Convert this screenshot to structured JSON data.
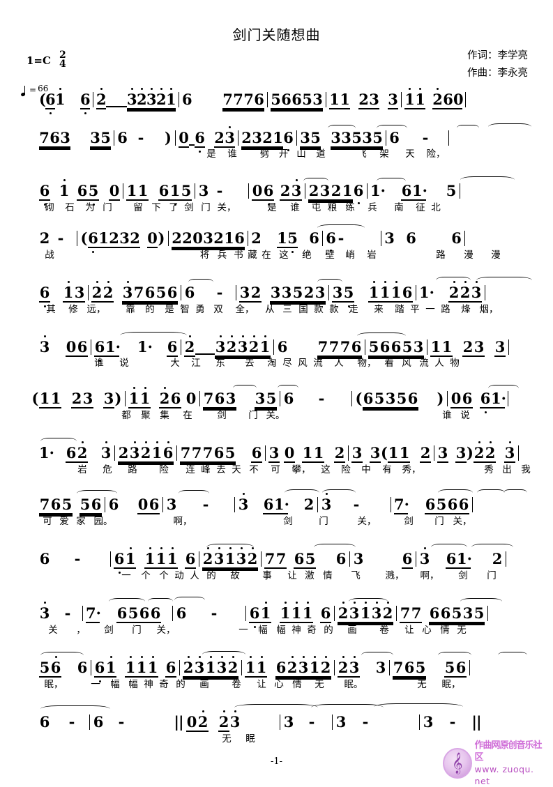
{
  "header": {
    "title": "剑门关随想曲",
    "lyricist": "作词：李学亮",
    "composer": "作曲：李永亮",
    "key_label": "1=C",
    "meter_num": "2",
    "meter_den": "4",
    "tempo_value": "66",
    "tempo_icon": "quarter-note-icon"
  },
  "footer": {
    "page_number": "-1-",
    "watermark_text": "作曲网原创音乐社区",
    "watermark_url": "www. zuoqu. net",
    "watermark_icon": "treble-clef-icon"
  },
  "score": {
    "lines": [
      {
        "id": "line-1",
        "notes": "( 6 1   6  | 2   3 2 3 2 1 | 6    7 7 7 6 | 5 6 6 5 3  | 1 1  2 3  3  | 1 1  2 6 0 |",
        "lyrics": ""
      },
      {
        "id": "line-2",
        "notes": "7 6 3   3 5 | 6  -   ) | 0 6  2 3 | 2 3 2 1 6 | 3 5  3 3 5 3 5 | 6   - |",
        "lyrics": "是 谁　劈开山 道　飞　架天　　险，"
      },
      {
        "id": "line-3",
        "notes": "6 1  6 5 0 | 1 1  6 1 5 | 3 - | 0 6 2 3 | 2 3 2 1 6 | 1· 6 1·  5 |",
        "lyrics": "砌 石 为门　留下 了剑门 关，　是谁　屯粮练 兵 南　征北"
      },
      {
        "id": "line-4",
        "notes": "2 - | 6 1 2 3 2  0 ) | 2 2 0 3 2 1 6 | 2  1 5  6 | 6 -   | 3 6   6 |",
        "lyrics": "战　　　　将兵 书藏在这　绝　壁峭 岩　　路 漫　　漫"
      },
      {
        "id": "line-5",
        "notes": "6  1 3 | 2 2  3 7 6 5 6 | 6   - | 3 2  3 3 5 2 3 | 3 5   1 1 1 6 | 1·  2 2 3 |",
        "lyrics": "其　修远，　靠的 是智勇双　全，　从三 国款款走　来　踏平一路烽　烟，"
      },
      {
        "id": "line-6",
        "notes": "3   0 6 | 6 1·  1·  6 | 2   3 2 3 2 1 | 6    7 7 7 6 | 5 6 6 5 3  | 1 1  2 3  3 |",
        "lyrics": "谁 说　　大　江东　去　淘尽风流人　物，　看风 流人物"
      },
      {
        "id": "line-7",
        "notes": "( 1 1  2 3  3 ) | 1 1  2 6 0 | 7 6 3   3 5 | 6   -   | ( 6 5 3 5 6   ) | 0 6  6 1· |",
        "lyrics": "都聚 集在　剑　门 关。　　　　　　　谁说"
      },
      {
        "id": "line-8",
        "notes": "1·  6 2  3 | 2 3 2 1 6 | 7 7 7 6 5  6 | 3 0  1 1  2 | 3  3 ( 1 1  2 | 3  3 ) 2 2  3 |",
        "lyrics": "岩 危 路　险　连峰去天不 可 攀，　这险 中 有 秀，　　　　秀出 我"
      },
      {
        "id": "line-9",
        "notes": "7 6 5  5 6 | 6   0 6 | 3   - | 3  6 1·  2 | 3   - | 7·  6 5 6 6 |",
        "lyrics": "可爱家 园。　　　啊，　　　剑　门　关，　　剑　门 关，"
      },
      {
        "id": "line-10",
        "notes": "6   - | 6 1  1 1 1  6 | 2 3 1 3 2 | 7 7  6 5   6 | 3    6 | 3   6 1·   2 |",
        "lyrics": "一个 个动人的 故　事　让激 情飞　　溅，　啊，剑　　门"
      },
      {
        "id": "line-11",
        "notes": "3   - | 7·  6 5 6 6 | 6   - | 6 1  1 1 1  6 | 2 3 1 3 2 | 7 7  6 6 5 3 5 |",
        "lyrics": "关 ，　剑　门 关，　　　一幅 幅神奇的 画　卷　让心 情无"
      },
      {
        "id": "line-12",
        "notes": "5 6   6 | 6 1  1 1 1  6 | 2 3 1 3 2 | 1 1  6 2 3 1 2 | 2 3  3 | 7 6 5   5 6 |",
        "lyrics": "眠，　　一幅 幅神奇的 画　卷　让心 情无　眠。　　无　　眠，"
      },
      {
        "id": "line-13",
        "notes": "6  - | 6  -     :|| 0 2  2 3   | 3  - | 3  -   | 3  - ||",
        "lyrics": "无 眠"
      }
    ]
  }
}
